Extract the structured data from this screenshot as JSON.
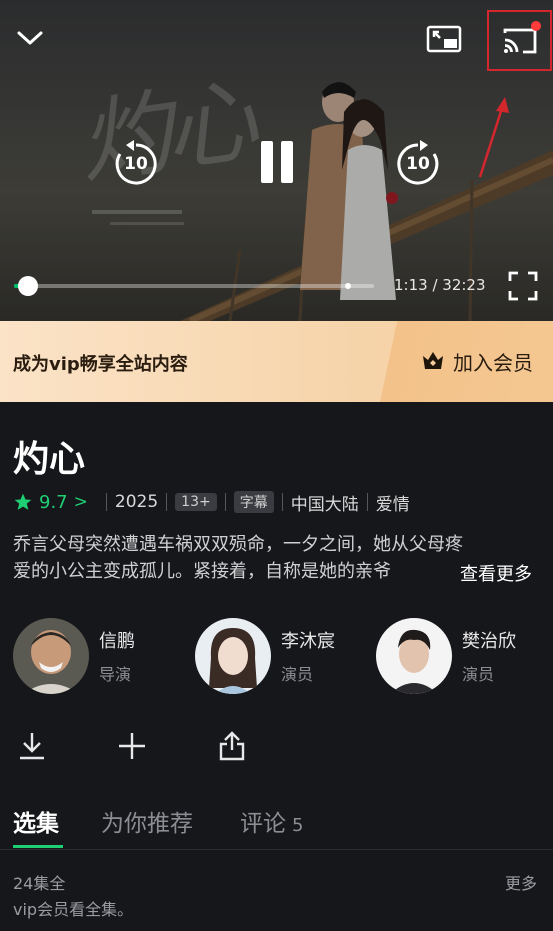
{
  "player": {
    "poster_title_art": "灼心",
    "skip_back_seconds": "10",
    "skip_forward_seconds": "10",
    "current_time": "1:13",
    "duration": "32:23",
    "time_display": "1:13 / 32:23",
    "progress_fraction": 0.0376,
    "cast_notification": true
  },
  "vip_banner": {
    "promo_text": "成为vip畅享全站内容",
    "join_label": "加入会员"
  },
  "show": {
    "title": "灼心",
    "rating": "9.7",
    "rating_chevron": ">",
    "year": "2025",
    "age_rating": "13+",
    "subtitle_tag": "字幕",
    "region": "中国大陆",
    "genre": "爱情",
    "description_line1": "乔言父母突然遭遇车祸双双殒命，一夕之间，她从父母疼",
    "description_line2": "爱的小公主变成孤儿。紧接着，自称是她的亲爷",
    "more_label": "查看更多"
  },
  "cast": [
    {
      "name": "信鹏",
      "role": "导演"
    },
    {
      "name": "李沐宸",
      "role": "演员"
    },
    {
      "name": "樊治欣",
      "role": "演员"
    }
  ],
  "tabs": [
    {
      "label": "选集"
    },
    {
      "label": "为你推荐"
    },
    {
      "label": "评论",
      "count": "5"
    }
  ],
  "episodes": {
    "count_label": "24集全",
    "note": "vip会员看全集。",
    "more_label": "更多"
  },
  "colors": {
    "accent_green": "#1fcf74",
    "highlight_red": "#d4262d",
    "background": "#16171b"
  }
}
